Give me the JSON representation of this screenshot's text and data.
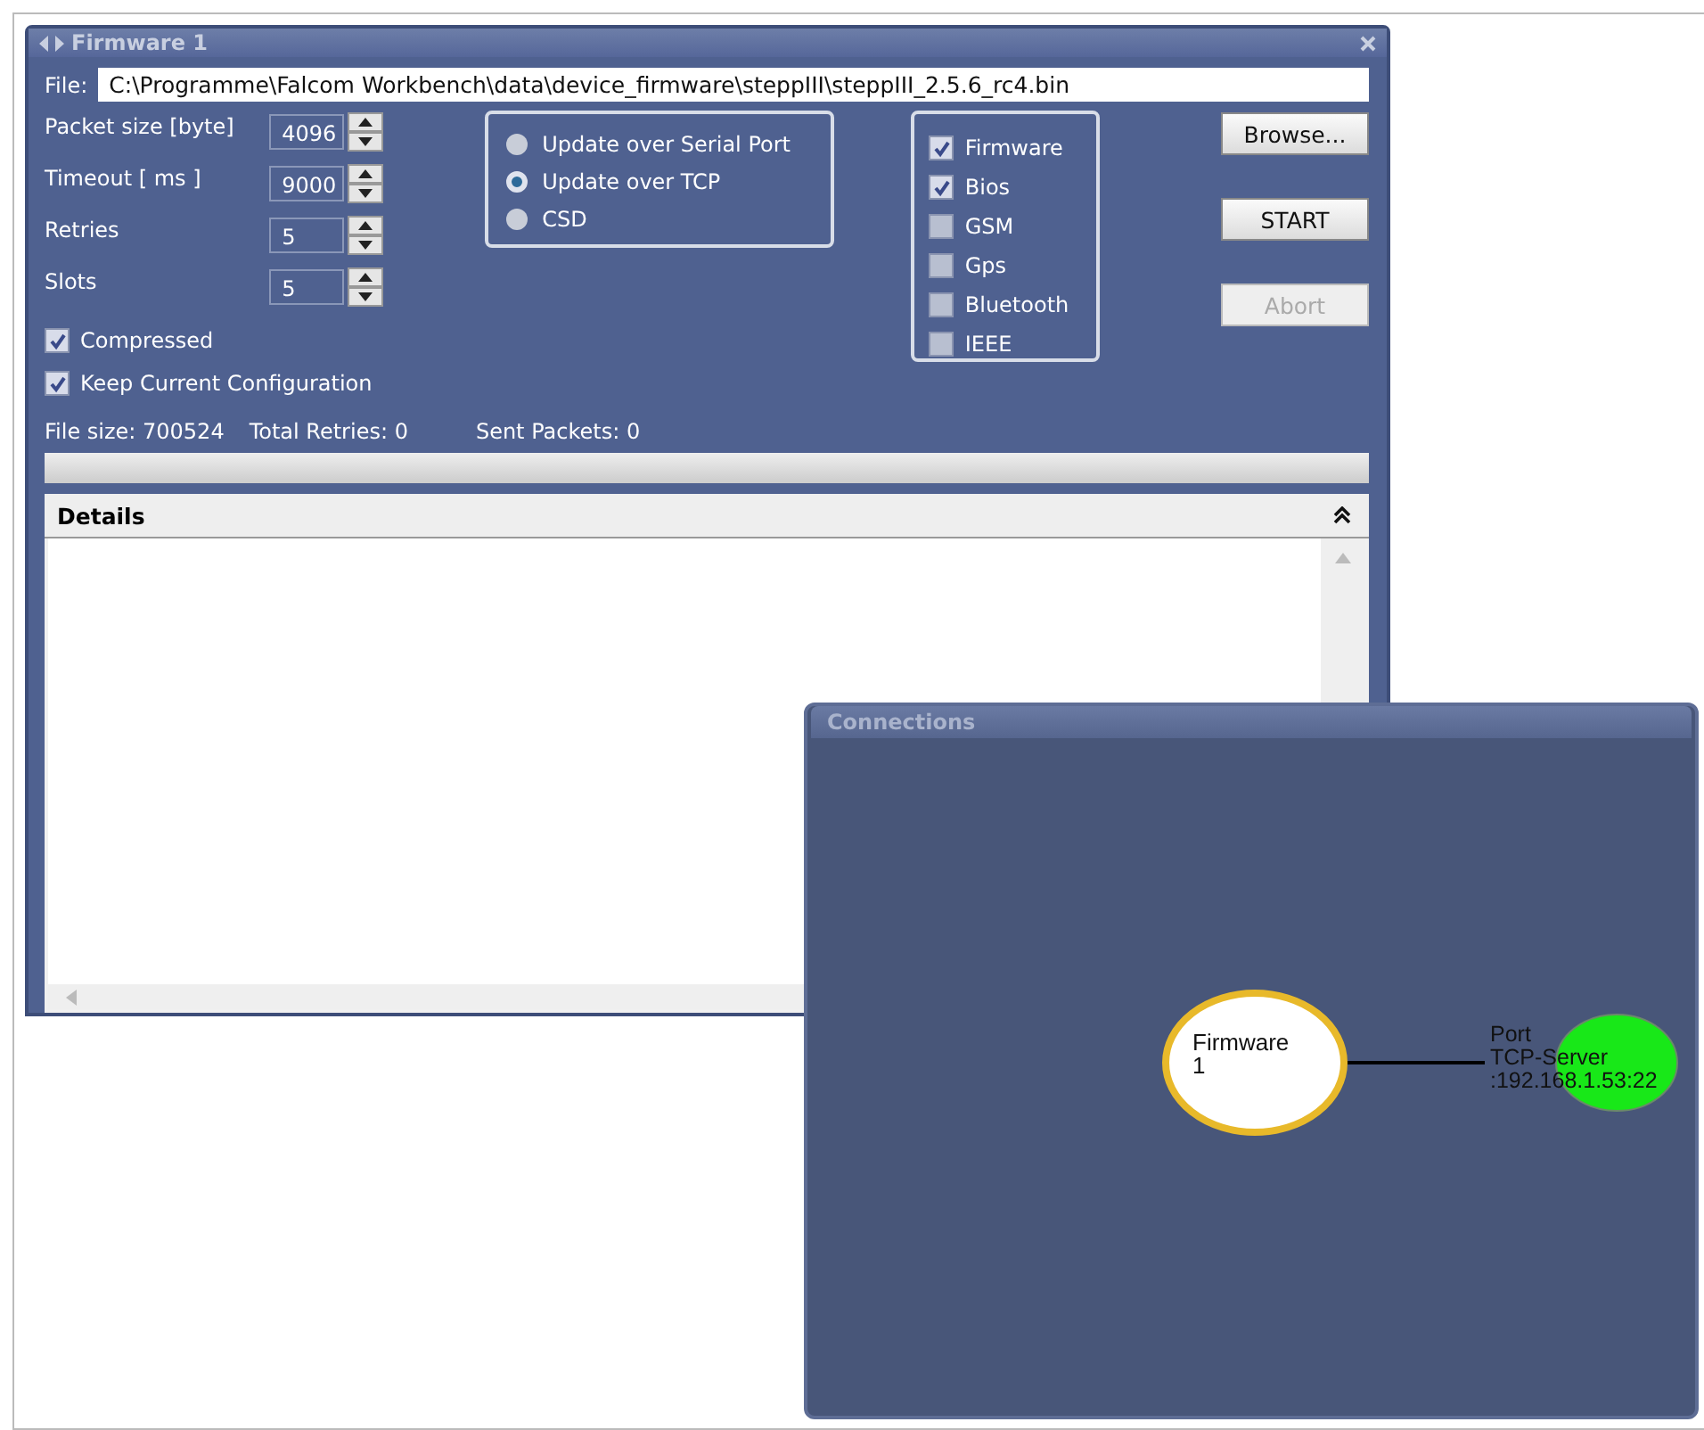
{
  "firmware_window": {
    "title": "Firmware 1",
    "file": {
      "label": "File:",
      "value": "C:\\Programme\\Falcom Workbench\\data\\device_firmware\\steppIII\\steppIII_2.5.6_rc4.bin"
    },
    "spinners": [
      {
        "label": "Packet size [byte]",
        "value": "4096"
      },
      {
        "label": "Timeout [ ms ]",
        "value": "9000"
      },
      {
        "label": "Retries",
        "value": "5"
      },
      {
        "label": "Slots",
        "value": "5"
      }
    ],
    "options": [
      {
        "label": "Compressed",
        "checked": true
      },
      {
        "label": "Keep Current Configuration",
        "checked": true
      }
    ],
    "update_modes": [
      {
        "label": "Update over Serial Port",
        "selected": false
      },
      {
        "label": "Update over TCP",
        "selected": true
      },
      {
        "label": "CSD",
        "selected": false
      }
    ],
    "components": [
      {
        "label": "Firmware",
        "checked": true
      },
      {
        "label": "Bios",
        "checked": true
      },
      {
        "label": "GSM",
        "checked": false
      },
      {
        "label": "Gps",
        "checked": false
      },
      {
        "label": "Bluetooth",
        "checked": false
      },
      {
        "label": "IEEE",
        "checked": false
      }
    ],
    "buttons": [
      {
        "label": "Browse...",
        "disabled": false
      },
      {
        "label": "START",
        "disabled": false
      },
      {
        "label": "Abort",
        "disabled": true
      }
    ],
    "status": [
      "File size: 700524",
      "Total Retries: 0",
      "Sent Packets: 0"
    ],
    "progress": {
      "level": 0
    },
    "details": {
      "title": "Details"
    }
  },
  "connections_window": {
    "title": "Connections",
    "nodes": [
      {
        "kind": "module",
        "lines": [
          "Firmware",
          "1"
        ]
      },
      {
        "kind": "port",
        "lines": [
          "Port",
          "TCP-Server",
          ":192.168.1.53:22"
        ]
      }
    ]
  }
}
